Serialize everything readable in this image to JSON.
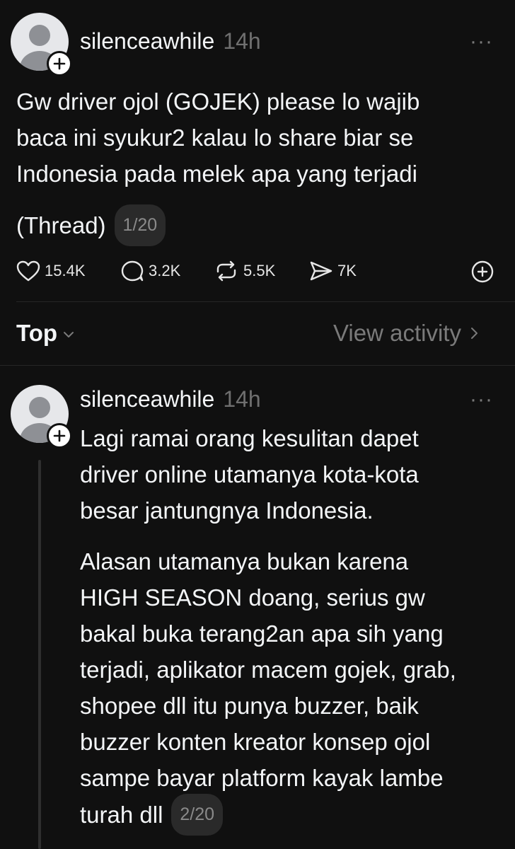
{
  "post1": {
    "username": "silenceawhile",
    "time": "14h",
    "more": "···",
    "text_lines": [
      "Gw driver ojol (GOJEK) please lo wajib",
      "baca ini syukur2 kalau lo share biar se",
      "Indonesia pada melek apa yang terjadi"
    ],
    "thread_label": "(Thread)",
    "counter": "1/20",
    "likes": "15.4K",
    "replies": "3.2K",
    "reposts": "5.5K",
    "shares": "7K"
  },
  "filter_bar": {
    "top_label": "Top",
    "view_activity": "View activity"
  },
  "post2": {
    "username": "silenceawhile",
    "time": "14h",
    "more": "···",
    "para1_lines": [
      "Lagi ramai orang kesulitan dapet",
      "driver online utamanya kota-kota",
      "besar jantungnya Indonesia."
    ],
    "para2_lines": [
      "Alasan utamanya bukan karena",
      "HIGH SEASON doang, serius gw",
      "bakal buka terang2an apa sih yang",
      "terjadi, aplikator macem gojek, grab,",
      "shopee dll itu punya buzzer, baik",
      "buzzer konten kreator konsep ojol",
      "sampe bayar platform kayak lambe"
    ],
    "last_line": "turah dll",
    "counter": "2/20"
  }
}
